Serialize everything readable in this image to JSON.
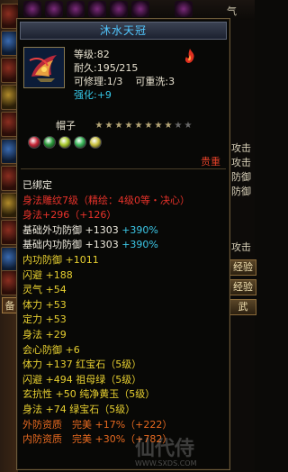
{
  "background": {
    "top_right_text": "气",
    "left_side_char": "备",
    "right_labels": [
      "攻击",
      "攻击",
      "防御",
      "防御",
      "攻击"
    ],
    "right_buttons": [
      "经验",
      "经验",
      "武"
    ]
  },
  "item": {
    "name": "沐水天冠",
    "level": "等级:82",
    "durability": "耐久:195/215",
    "repair": "可修理:1/3",
    "wash": "可重洗:3",
    "strengthen_label": "强化:",
    "strengthen_value": "+9",
    "type": "帽子",
    "stars_filled": 8,
    "stars_total": 10,
    "gem_colors": [
      "#c82a3a",
      "#2a9a3a",
      "#a8c830",
      "#3ab85a",
      "#c8c040"
    ],
    "rank": "贵重"
  },
  "attributes": [
    {
      "parts": [
        {
          "text": "已绑定",
          "color": "white"
        }
      ]
    },
    {
      "parts": [
        {
          "text": "身法雕纹7级（精绘：4级0等・决心）",
          "color": "red"
        }
      ]
    },
    {
      "parts": [
        {
          "text": "身法+296（+126）",
          "color": "red"
        }
      ]
    },
    {
      "parts": [
        {
          "text": "基础外功防御 +1303 ",
          "color": "white"
        },
        {
          "text": "+390%",
          "color": "cyan"
        }
      ]
    },
    {
      "parts": [
        {
          "text": "基础内功防御 +1303 ",
          "color": "white"
        },
        {
          "text": "+390%",
          "color": "cyan"
        }
      ]
    },
    {
      "parts": [
        {
          "text": "内功防御 +1011",
          "color": "yellow"
        }
      ]
    },
    {
      "parts": [
        {
          "text": "闪避 +188",
          "color": "yellow"
        }
      ]
    },
    {
      "parts": [
        {
          "text": "灵气 +54",
          "color": "yellow"
        }
      ]
    },
    {
      "parts": [
        {
          "text": "体力 +53",
          "color": "yellow"
        }
      ]
    },
    {
      "parts": [
        {
          "text": "定力 +53",
          "color": "yellow"
        }
      ]
    },
    {
      "parts": [
        {
          "text": "身法 +29",
          "color": "yellow"
        }
      ]
    },
    {
      "parts": [
        {
          "text": "会心防御 +6",
          "color": "yellow"
        }
      ]
    },
    {
      "parts": [
        {
          "text": "体力 +137 红宝石（5级）",
          "color": "yellow"
        }
      ]
    },
    {
      "parts": [
        {
          "text": "闪避 +494 祖母绿（5级）",
          "color": "yellow"
        }
      ]
    },
    {
      "parts": [
        {
          "text": "玄抗性 +50 纯净黄玉（5级）",
          "color": "yellow"
        }
      ]
    },
    {
      "parts": [
        {
          "text": "身法 +74 绿宝石（5级）",
          "color": "yellow"
        }
      ]
    },
    {
      "parts": [
        {
          "text": "外防资质　完美 +17%（+222）",
          "color": "orange"
        }
      ]
    },
    {
      "parts": [
        {
          "text": "内防资质　完美 +30%（+782）",
          "color": "orange"
        }
      ]
    }
  ],
  "watermark": {
    "text": "仙代侍",
    "url": "WWW.SXDS.COM"
  }
}
